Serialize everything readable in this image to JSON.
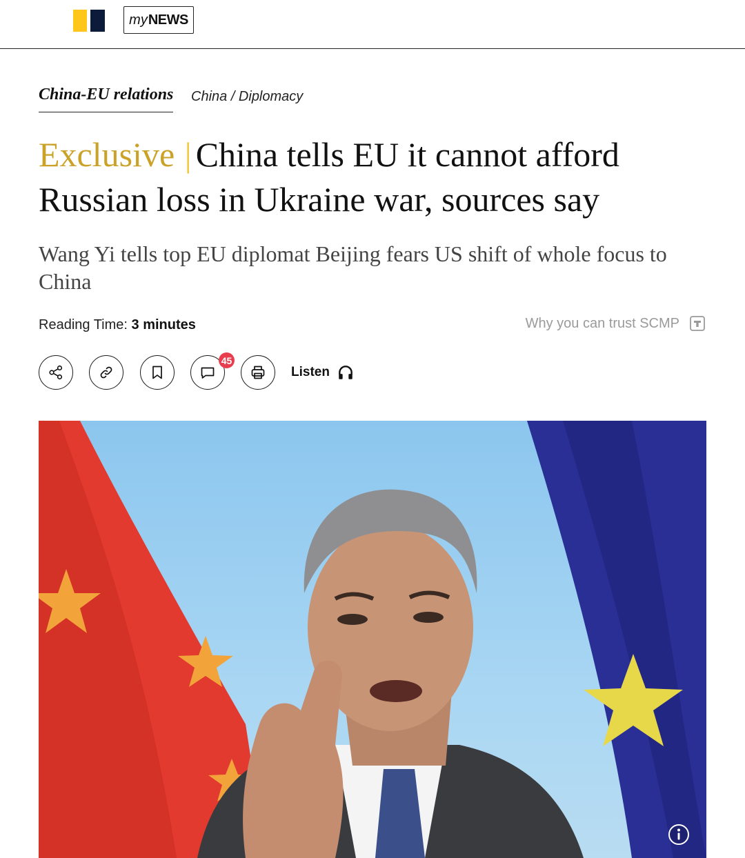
{
  "header": {
    "brand_logo": "scmp-logo",
    "mynews_prefix": "my",
    "mynews_suffix": "NEWS"
  },
  "breadcrumb": {
    "primary": "China-EU relations",
    "secondary": "China / Diplomacy"
  },
  "article": {
    "tag": "Exclusive",
    "separator": "|",
    "headline": "China tells EU it cannot afford Russian loss in Ukraine war, sources say",
    "subheadline": "Wang Yi tells top EU diplomat Beijing fears US shift of whole focus to China",
    "reading_time_label": "Reading Time:",
    "reading_time_value": "3 minutes",
    "trust_link": "Why you can trust SCMP"
  },
  "actions": {
    "icons": [
      "share-icon",
      "link-icon",
      "bookmark-icon",
      "comment-icon",
      "print-icon"
    ],
    "comment_count": "45",
    "listen_label": "Listen",
    "listen_icon": "headphones-icon"
  },
  "photo": {
    "description_icon": "info-icon"
  },
  "colors": {
    "tag_gold": "#c9a227",
    "badge_red": "#e83d4f",
    "logo_yellow": "#ffc61b",
    "logo_navy": "#0c1b3a",
    "trust_gray": "#9a9a9a"
  }
}
